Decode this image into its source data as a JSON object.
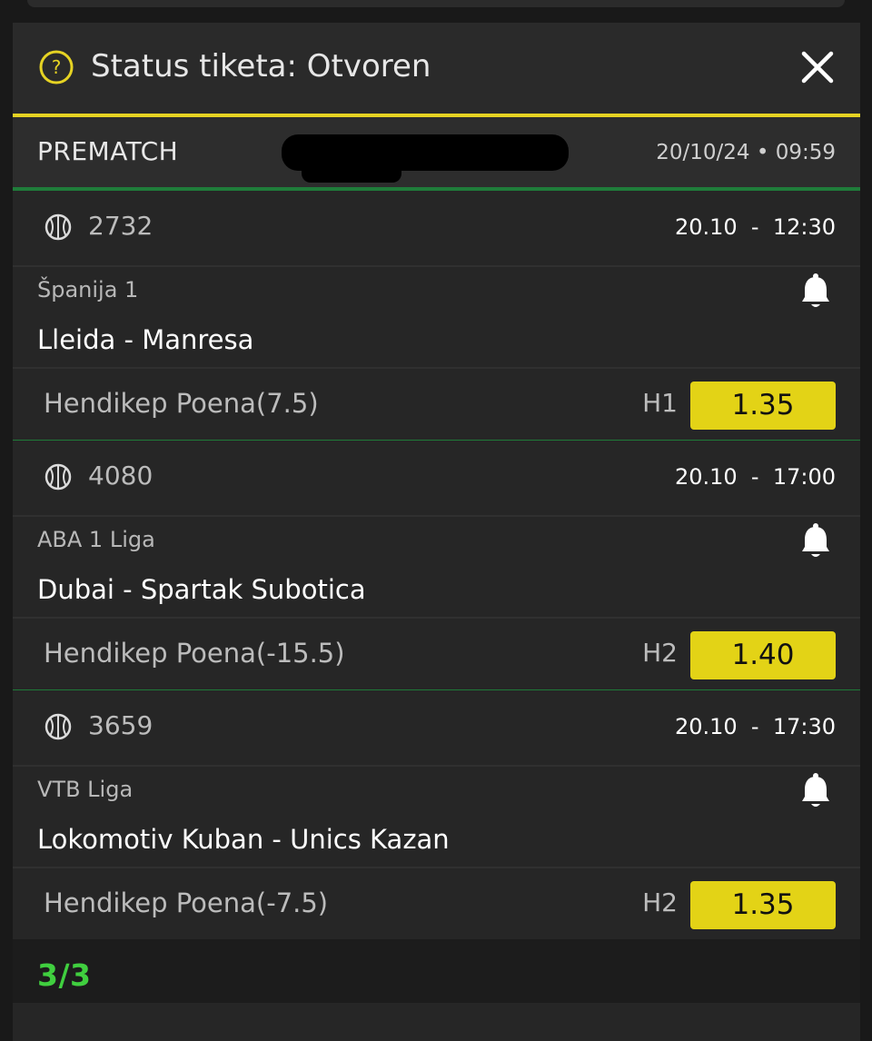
{
  "header": {
    "title": "Status tiketa: Otvoren",
    "accent_color": "#e6d323",
    "help_icon": "question-icon",
    "close_icon": "close-icon"
  },
  "ticket": {
    "label": "PREMATCH",
    "datetime": "20/10/24 • 09:59"
  },
  "matches": [
    {
      "sport_icon": "basketball-icon",
      "id": "2732",
      "time": "20.10  -  12:30",
      "league": "Španija 1",
      "teams": "Lleida - Manresa",
      "market": "Hendikep Poena(7.5)",
      "pick": "H1",
      "odd": "1.35"
    },
    {
      "sport_icon": "basketball-icon",
      "id": "4080",
      "time": "20.10  -  17:00",
      "league": "ABA 1 Liga",
      "teams": "Dubai - Spartak Subotica",
      "market": "Hendikep Poena(-15.5)",
      "pick": "H2",
      "odd": "1.40"
    },
    {
      "sport_icon": "basketball-icon",
      "id": "3659",
      "time": "20.10  -  17:30",
      "league": "VTB Liga",
      "teams": "Lokomotiv Kuban - Unics Kazan",
      "market": "Hendikep Poena(-7.5)",
      "pick": "H2",
      "odd": "1.35"
    }
  ],
  "footer": {
    "status": "3/3",
    "status_color": "#40cf3f"
  }
}
